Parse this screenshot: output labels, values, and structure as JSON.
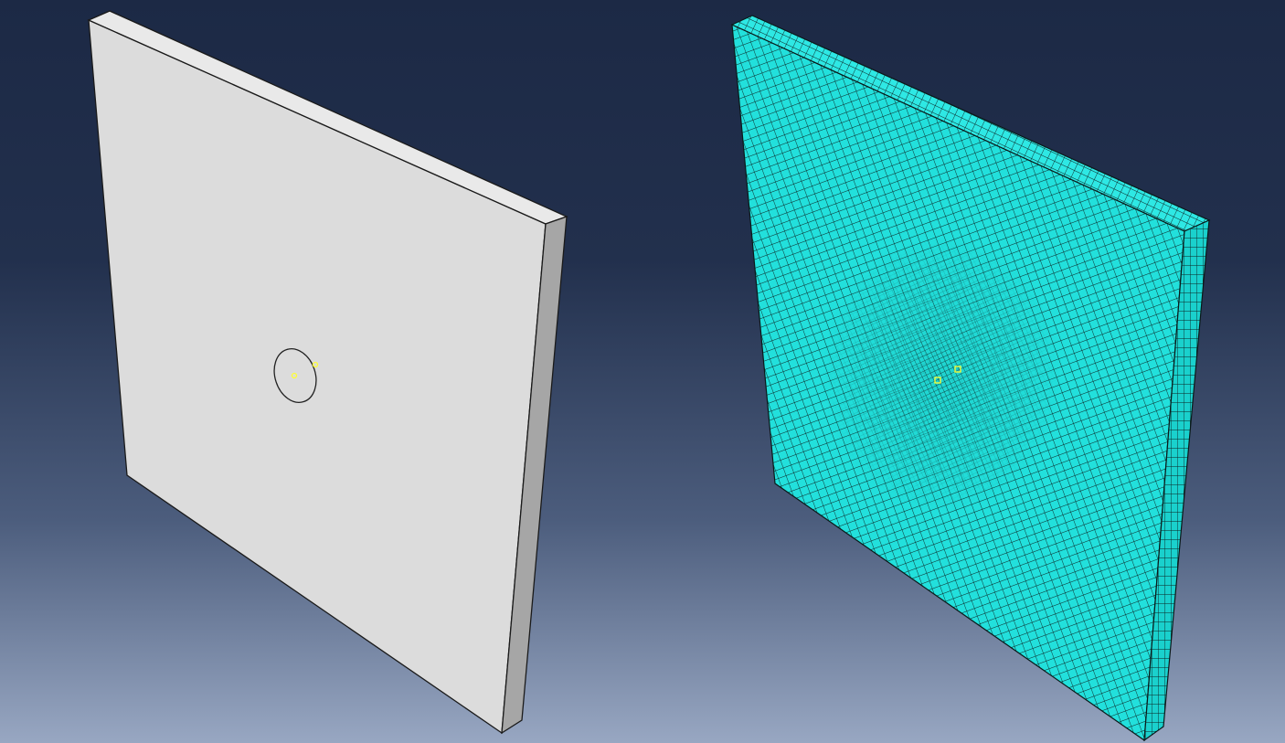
{
  "viewports": [
    {
      "model": "plate-with-hole",
      "display": "geometry",
      "face_color": "#dcdcdc",
      "side_color": "#a6a6a6",
      "top_color": "#e9e9e9",
      "edge_color": "#1a1a1a",
      "marker_color": "#ffff33"
    },
    {
      "model": "plate-with-hole",
      "display": "mesh",
      "face_color": "#22e0dc",
      "side_color": "#1ad1cd",
      "top_color": "#2ee8e4",
      "edge_color": "#0a1a1a",
      "marker_color": "#ffff33"
    }
  ],
  "background": {
    "top_color": "#1c2945",
    "bottom_color": "#98a7c2"
  }
}
